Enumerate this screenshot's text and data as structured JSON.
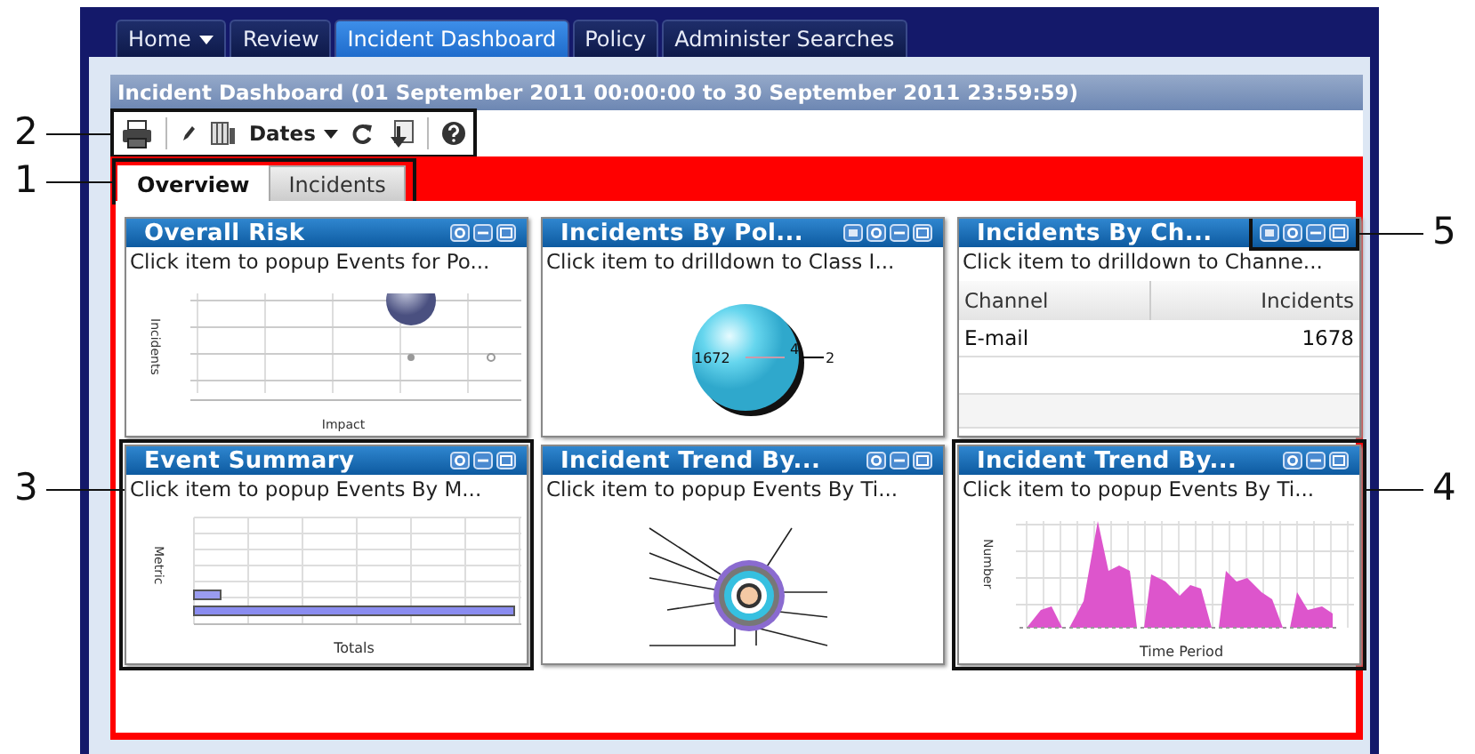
{
  "nav_tabs": [
    {
      "label": "Home",
      "dropdown": true,
      "selected": false
    },
    {
      "label": "Review",
      "dropdown": false,
      "selected": false
    },
    {
      "label": "Incident Dashboard",
      "dropdown": false,
      "selected": true
    },
    {
      "label": "Policy",
      "dropdown": false,
      "selected": false
    },
    {
      "label": "Administer Searches",
      "dropdown": false,
      "selected": false
    }
  ],
  "dashboard": {
    "title": "Incident Dashboard (01 September 2011 00:00:00 to 30 September 2011 23:59:59)"
  },
  "toolbar": {
    "callout": "2",
    "items": [
      {
        "kind": "print"
      },
      {
        "kind": "separator"
      },
      {
        "kind": "edit"
      },
      {
        "kind": "columns"
      },
      {
        "kind": "dropdown",
        "label": "Dates"
      },
      {
        "kind": "refresh"
      },
      {
        "kind": "export"
      },
      {
        "kind": "separator"
      },
      {
        "kind": "help"
      }
    ]
  },
  "view_tabs": {
    "callout": "1",
    "tabs": [
      {
        "label": "Overview",
        "selected": true
      },
      {
        "label": "Incidents",
        "selected": false
      }
    ]
  },
  "widgets": [
    {
      "title": "Overall Risk",
      "subtitle": "Click item to popup Events for Po...",
      "kind": "bubble",
      "xlabel": "Impact",
      "ylabel": "Incidents",
      "buttons": [
        {
          "kind": "settings"
        },
        {
          "kind": "minimize"
        },
        {
          "kind": "maximize"
        }
      ]
    },
    {
      "title": "Incidents By Pol...",
      "subtitle": "Click item to drilldown to Class I...",
      "kind": "sphere",
      "labels": [
        "1672",
        "4",
        "2"
      ],
      "buttons": [
        {
          "kind": "chart"
        },
        {
          "kind": "settings"
        },
        {
          "kind": "minimize"
        },
        {
          "kind": "maximize"
        }
      ]
    },
    {
      "title": "Incidents By Ch...",
      "subtitle": "Click item to drilldown to Channe...",
      "kind": "table",
      "columns": [
        "Channel",
        "Incidents"
      ],
      "rows": [
        [
          "E-mail",
          "1678"
        ]
      ],
      "buttons": [
        {
          "kind": "chart"
        },
        {
          "kind": "settings"
        },
        {
          "kind": "minimize"
        },
        {
          "kind": "maximize"
        }
      ],
      "buttons_callout": "5"
    },
    {
      "title": "Event Summary",
      "subtitle": "Click item to popup Events By M...",
      "kind": "bar",
      "xlabel": "Totals",
      "ylabel": "Metric",
      "buttons": [
        {
          "kind": "settings"
        },
        {
          "kind": "minimize"
        },
        {
          "kind": "maximize"
        }
      ],
      "callout": "3"
    },
    {
      "title": "Incident Trend By...",
      "subtitle": "Click item to popup Events By Ti...",
      "kind": "donut",
      "buttons": [
        {
          "kind": "settings"
        },
        {
          "kind": "minimize"
        },
        {
          "kind": "maximize"
        }
      ]
    },
    {
      "title": "Incident Trend By...",
      "subtitle": "Click item to popup Events By Ti...",
      "kind": "area",
      "xlabel": "Time Period",
      "ylabel": "Number",
      "buttons": [
        {
          "kind": "settings"
        },
        {
          "kind": "minimize"
        },
        {
          "kind": "maximize"
        }
      ],
      "callout": "4"
    }
  ]
}
